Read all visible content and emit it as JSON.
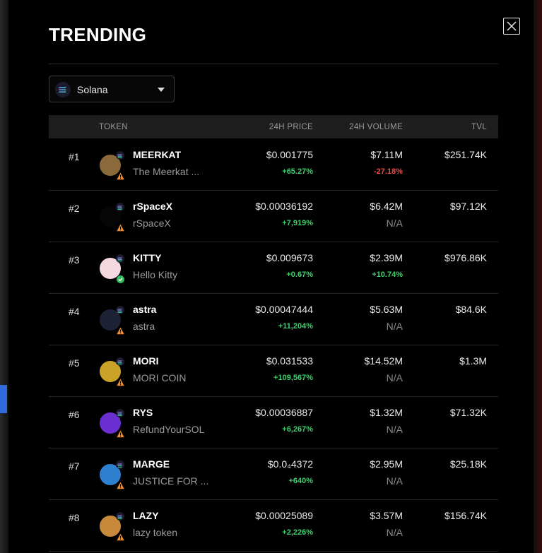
{
  "modal": {
    "title": "TRENDING",
    "close_icon": "close-icon"
  },
  "chain_select": {
    "value": "Solana",
    "icon": "solana-icon"
  },
  "table": {
    "headers": {
      "token": "TOKEN",
      "price": "24H PRICE",
      "volume": "24H VOLUME",
      "tvl": "TVL"
    },
    "rows": [
      {
        "rank": "#1",
        "symbol": "MEERKAT",
        "name": "The Meerkat ...",
        "price": "$0.001775",
        "price_change": "+65.27%",
        "volume": "$7.11M",
        "volume_change": "-27.18%",
        "tvl": "$251.74K",
        "status": "warning",
        "avatar_color": "#8a6a3a"
      },
      {
        "rank": "#2",
        "symbol": "rSpaceX",
        "name": "rSpaceX",
        "price": "$0.00036192",
        "price_change": "+7,919%",
        "volume": "$6.42M",
        "volume_change": "N/A",
        "tvl": "$97.12K",
        "status": "warning",
        "avatar_color": "#050505"
      },
      {
        "rank": "#3",
        "symbol": "KITTY",
        "name": "Hello Kitty",
        "price": "$0.009673",
        "price_change": "+0.67%",
        "volume": "$2.39M",
        "volume_change": "+10.74%",
        "tvl": "$976.86K",
        "status": "verified",
        "avatar_color": "#f4d7df"
      },
      {
        "rank": "#4",
        "symbol": "astra",
        "name": "astra",
        "price": "$0.00047444",
        "price_change": "+11,204%",
        "volume": "$5.63M",
        "volume_change": "N/A",
        "tvl": "$84.6K",
        "status": "warning",
        "avatar_color": "#1c2136"
      },
      {
        "rank": "#5",
        "symbol": "MORI",
        "name": "MORI COIN",
        "price": "$0.031533",
        "price_change": "+109,567%",
        "volume": "$14.52M",
        "volume_change": "N/A",
        "tvl": "$1.3M",
        "status": "warning",
        "avatar_color": "#c9a227"
      },
      {
        "rank": "#6",
        "symbol": "RYS",
        "name": "RefundYourSOL",
        "price": "$0.00036887",
        "price_change": "+6,267%",
        "volume": "$1.32M",
        "volume_change": "N/A",
        "tvl": "$71.32K",
        "status": "warning",
        "avatar_color": "#6a2fd0"
      },
      {
        "rank": "#7",
        "symbol": "MARGE",
        "name": "JUSTICE FOR ...",
        "price": "$0.0₄4372",
        "price_change": "+640%",
        "volume": "$2.95M",
        "volume_change": "N/A",
        "tvl": "$25.18K",
        "status": "warning",
        "avatar_color": "#2f7fd0"
      },
      {
        "rank": "#8",
        "symbol": "LAZY",
        "name": "lazy token",
        "price": "$0.00025089",
        "price_change": "+2,226%",
        "volume": "$3.57M",
        "volume_change": "N/A",
        "tvl": "$156.74K",
        "status": "warning",
        "avatar_color": "#c88a3a"
      }
    ]
  },
  "colors": {
    "positive": "#3fcf6f",
    "negative": "#ef4b4b",
    "warning": "#f08a2c",
    "verified": "#2fbf5f"
  }
}
